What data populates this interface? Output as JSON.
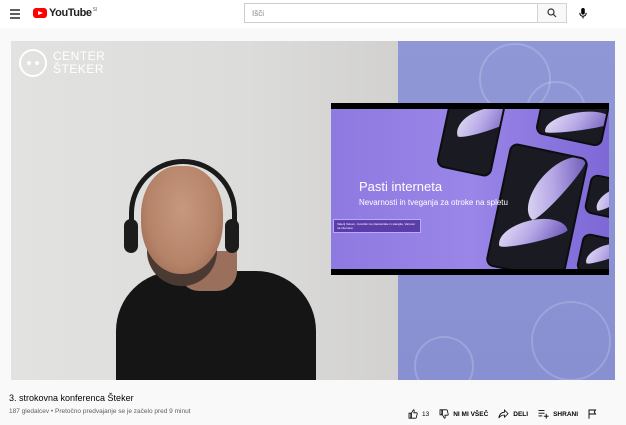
{
  "header": {
    "logo_text": "YouTube",
    "logo_suffix": "SI",
    "search_placeholder": "Išči",
    "icons": [
      "menu-icon",
      "search-icon",
      "microphone-icon"
    ],
    "brand_color": "#ff0000"
  },
  "video": {
    "overlay_brand": {
      "line1": "CENTER",
      "line2": "ŠTEKER"
    },
    "slide": {
      "title": "Pasti interneta",
      "subtitle": "Nevarnosti in tveganja za otroke na spletu",
      "tag": "Valerij Vekom, Uvodnik za mladostnike in starejše, Varnost na internetu"
    },
    "colors": {
      "wall_right": "#8f97d6",
      "slide_bg": "#9a86e8"
    }
  },
  "info": {
    "title": "3. strokovna konferenca Šteker",
    "meta": "187 gledalcev • Pretočno predvajanje se je začelo pred 9 minut",
    "like_count": "13",
    "dislike_label": "NI MI VŠEČ",
    "share_label": "DELI",
    "save_label": "SHRANI"
  }
}
